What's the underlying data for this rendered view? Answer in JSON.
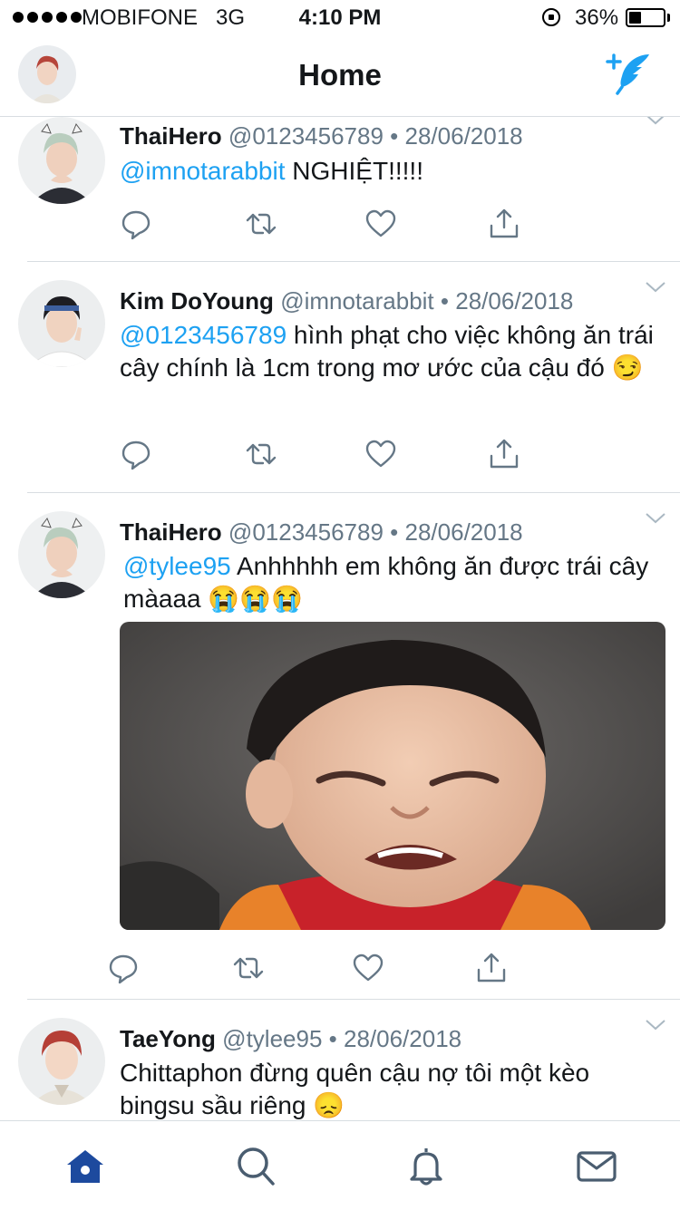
{
  "status_bar": {
    "carrier": "MOBIFONE",
    "network": "3G",
    "time": "4:10 PM",
    "battery": "36%",
    "battery_level": 0.36
  },
  "header": {
    "title": "Home",
    "compose_icon": "compose-feather-icon",
    "accent_color": "#1da1f2"
  },
  "tweets": [
    {
      "name": "ThaiHero",
      "handle": "@0123456789",
      "date": "28/06/2018",
      "mention": "@imnotarabbit",
      "text": " NGHIỆT!!!!!"
    },
    {
      "name": "Kim DoYoung",
      "handle": "@imnotarabbit",
      "date": "28/06/2018",
      "mention": "@0123456789",
      "text": " hình phạt cho việc không ăn trái cây chính là 1cm trong mơ ước của cậu đó 😏"
    },
    {
      "name": "ThaiHero",
      "handle": "@0123456789",
      "date": "28/06/2018",
      "mention": "@tylee95",
      "text": " Anhhhhh em không ăn được trái cây màaaa 😭😭😭",
      "media": "crying-child-photo"
    },
    {
      "name": "TaeYong",
      "handle": "@tylee95",
      "date": "28/06/2018",
      "mention": "",
      "text": "Chittaphon đừng quên cậu nợ tôi một kèo bingsu sầu riêng 😞"
    }
  ],
  "separator": "•",
  "tabbar": {
    "items": [
      "home-icon",
      "search-icon",
      "notifications-bell-icon",
      "messages-envelope-icon"
    ],
    "active": "home-icon",
    "active_color": "#1da1f2",
    "inactive_color": "#657786"
  }
}
